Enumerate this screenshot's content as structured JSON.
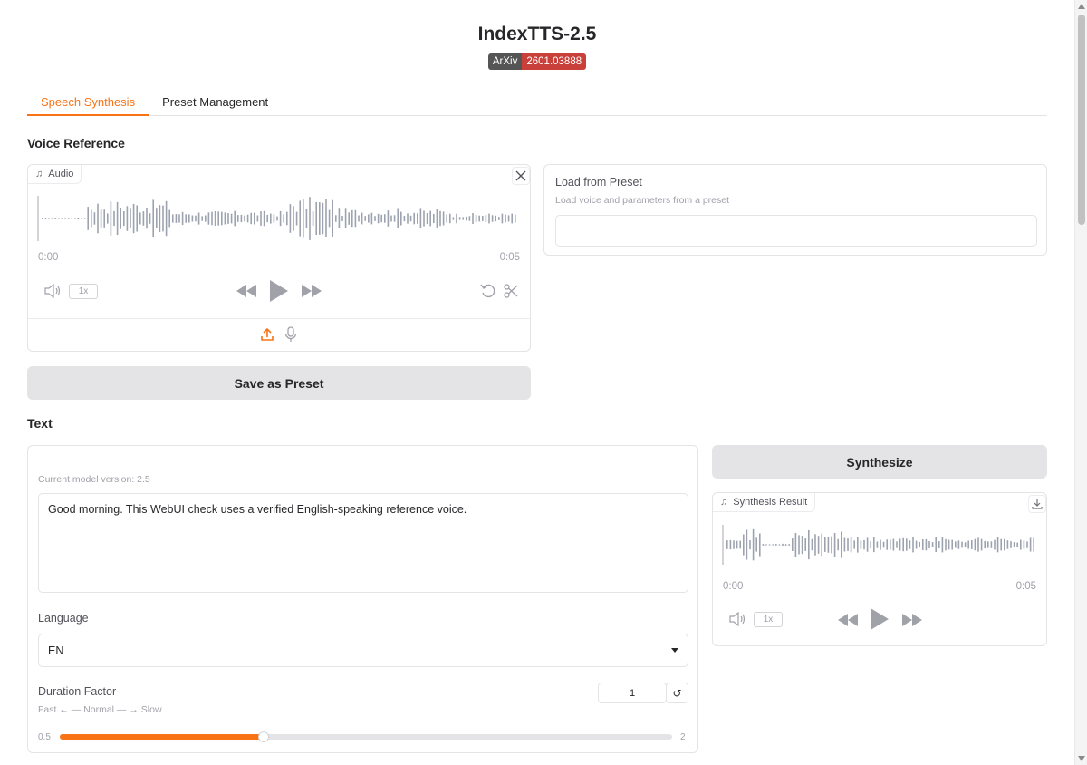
{
  "header": {
    "title": "IndexTTS-2.5",
    "badge_left": "ArXiv",
    "badge_right": "2601.03888"
  },
  "tabs": [
    {
      "label": "Speech Synthesis",
      "active": true
    },
    {
      "label": "Preset Management",
      "active": false
    }
  ],
  "voice_reference": {
    "section_title": "Voice Reference",
    "audio": {
      "label": "Audio",
      "time_start": "0:00",
      "time_end": "0:05",
      "speed": "1x"
    },
    "save_preset_label": "Save as Preset"
  },
  "load_preset": {
    "label": "Load from Preset",
    "info": "Load voice and parameters from a preset",
    "value": ""
  },
  "text_section": {
    "section_title": "Text",
    "model_version": "Current model version: 2.5",
    "text_value": "Good morning. This WebUI check uses a verified English-speaking reference voice.",
    "language_label": "Language",
    "language_value": "EN",
    "duration": {
      "label": "Duration Factor",
      "info": "Fast ← — Normal — → Slow",
      "value": "1",
      "min": "0.5",
      "max": "2",
      "fraction": 0.333
    }
  },
  "synthesis": {
    "button_label": "Synthesize",
    "result_label": "Synthesis Result",
    "time_start": "0:00",
    "time_end": "0:05",
    "speed": "1x"
  },
  "colors": {
    "accent": "#f97316",
    "badge_red": "#c9403a",
    "badge_gray": "#555555"
  }
}
